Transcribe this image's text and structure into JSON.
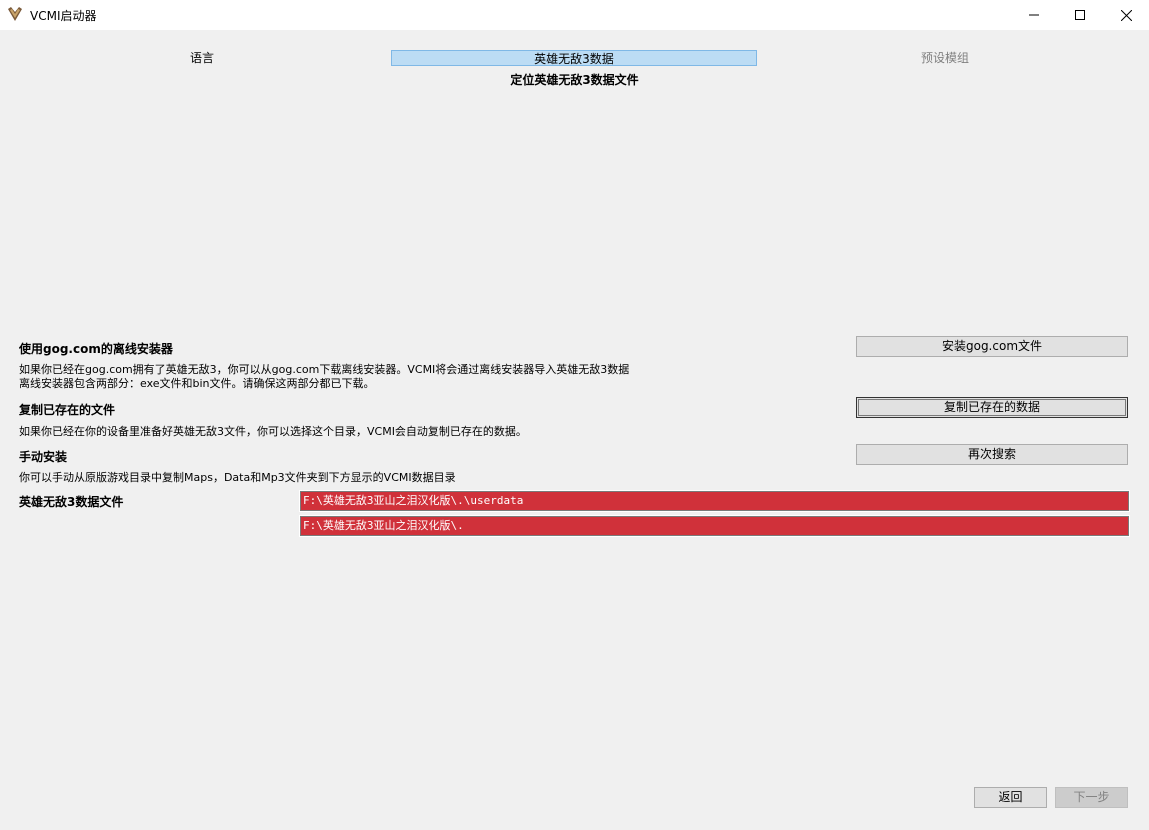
{
  "window": {
    "title": "VCMI启动器",
    "icon": "vcmi-logo-icon"
  },
  "steps": {
    "language": "语言",
    "heroes_data": "英雄无敌3数据",
    "preset_mods": "预设模组"
  },
  "page_title": "定位英雄无敌3数据文件",
  "gog": {
    "heading": "使用gog.com的离线安装器",
    "desc_line1": "如果你已经在gog.com拥有了英雄无敌3，你可以从gog.com下载离线安装器。VCMI将会通过离线安装器导入英雄无敌3数据",
    "desc_line2": "离线安装器包含两部分：exe文件和bin文件。请确保这两部分都已下载。",
    "button": "安装gog.com文件"
  },
  "copy": {
    "heading": "复制已存在的文件",
    "desc": "如果你已经在你的设备里准备好英雄无敌3文件，你可以选择这个目录，VCMI会自动复制已存在的数据。",
    "button": "复制已存在的数据"
  },
  "manual": {
    "heading": "手动安装",
    "desc": "你可以手动从原版游戏目录中复制Maps，Data和Mp3文件夹到下方显示的VCMI数据目录",
    "button": "再次搜索"
  },
  "data_files": {
    "label": "英雄无敌3数据文件",
    "path_user": "F:\\英雄无敌3亚山之泪汉化版\\.\\userdata",
    "path_game": "F:\\英雄无敌3亚山之泪汉化版\\."
  },
  "nav": {
    "back": "返回",
    "next": "下一步"
  },
  "colors": {
    "active_step": "#bcdcf4",
    "path_error": "#d0313a"
  }
}
